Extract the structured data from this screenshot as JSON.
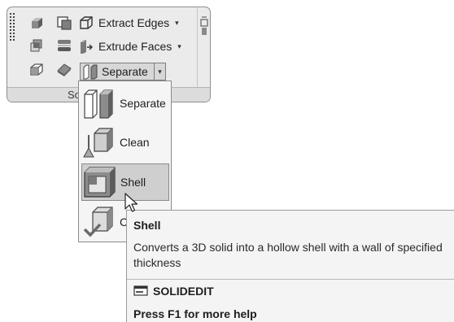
{
  "ribbon_panel": {
    "title": "Solid Editing",
    "buttons": {
      "extract_edges": "Extract Edges",
      "extrude_faces": "Extrude Faces",
      "separate": "Separate"
    },
    "icons": [
      "union-icon",
      "subtract-icon",
      "interfere-icon",
      "slice-icon",
      "thicken-icon",
      "imprint-icon",
      "extract-edges-icon",
      "extrude-faces-icon",
      "separate-icon",
      "pin-icon"
    ]
  },
  "dropdown": {
    "items": [
      {
        "label": "Separate",
        "icon": "separate-icon"
      },
      {
        "label": "Clean",
        "icon": "clean-icon"
      },
      {
        "label": "Shell",
        "icon": "shell-icon",
        "selected": true
      },
      {
        "label": "Check",
        "icon": "check-icon"
      }
    ]
  },
  "tooltip": {
    "title": "Shell",
    "description": "Converts a 3D solid into a hollow shell with a wall of specified thickness",
    "command": "SOLIDEDIT",
    "help": "Press F1 for more help"
  },
  "colors": {
    "panel_bg": "#ebebeb",
    "menu_bg": "#f5f5f5",
    "selected_bg": "#cfcfcf",
    "tooltip_bg": "#f4f4f4",
    "border": "#8a8a8a"
  }
}
